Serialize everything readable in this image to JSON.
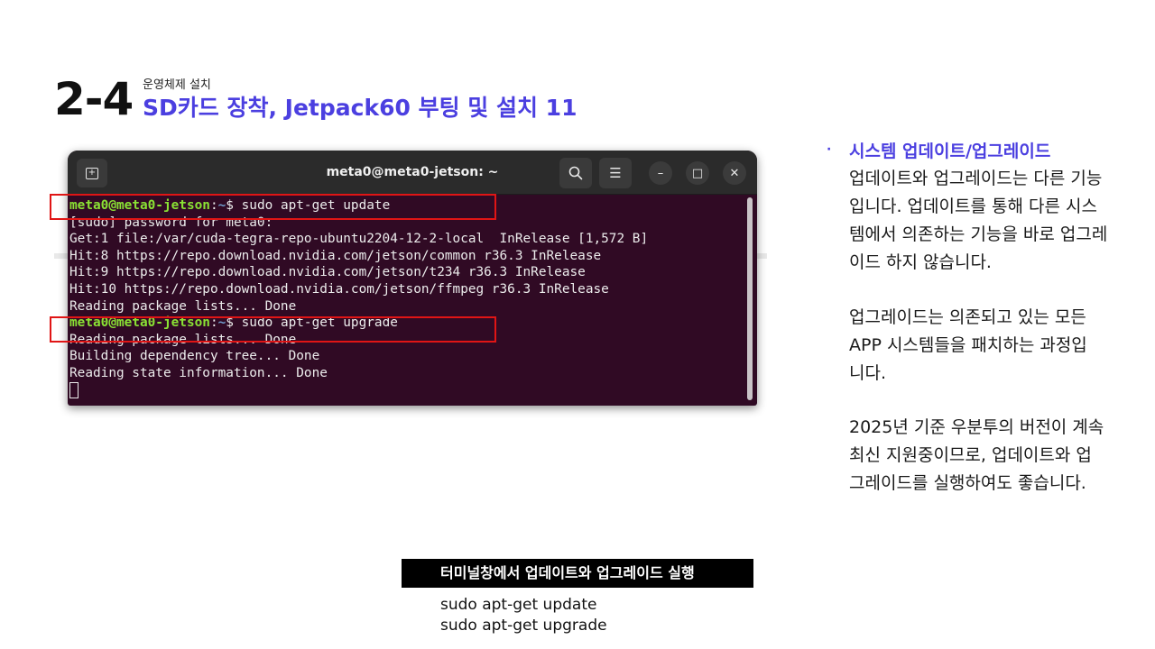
{
  "header": {
    "section_number": "2-4",
    "subtitle": "운영체제 설치",
    "title": "SD카드 장착, Jetpack60 부팅 및 설치 11"
  },
  "terminal": {
    "window_title": "meta0@meta0-jetson: ~",
    "buttons": {
      "new_tab": "⊞",
      "search": "search-icon",
      "menu": "☰",
      "minimize": "–",
      "maximize": "□",
      "close": "✕"
    },
    "prompt_user": "meta0@meta0-jetson",
    "prompt_colon": ":",
    "prompt_path": "~",
    "prompt_sign": "$ ",
    "lines": [
      {
        "kind": "prompt",
        "cmd": "sudo apt-get update"
      },
      {
        "kind": "text",
        "text": "[sudo] password for meta0:"
      },
      {
        "kind": "text",
        "text": "Get:1 file:/var/cuda-tegra-repo-ubuntu2204-12-2-local  InRelease [1,572 B]"
      },
      {
        "kind": "text",
        "text": "Hit:8 https://repo.download.nvidia.com/jetson/common r36.3 InRelease"
      },
      {
        "kind": "text",
        "text": "Hit:9 https://repo.download.nvidia.com/jetson/t234 r36.3 InRelease"
      },
      {
        "kind": "text",
        "text": "Hit:10 https://repo.download.nvidia.com/jetson/ffmpeg r36.3 InRelease"
      },
      {
        "kind": "text",
        "text": "Reading package lists... Done"
      },
      {
        "kind": "prompt",
        "cmd": "sudo apt-get upgrade"
      },
      {
        "kind": "text",
        "text": "Reading package lists... Done"
      },
      {
        "kind": "text",
        "text": "Building dependency tree... Done"
      },
      {
        "kind": "text",
        "text": "Reading state information... Done"
      }
    ]
  },
  "bullets": {
    "title": "시스템 업데이트/업그레이드",
    "paragraphs": [
      [
        "업데이트와 업그레이드는 다른 기능",
        "입니다. 업데이트를 통해 다른 시스",
        "템에서 의존하는 기능을 바로 업그레",
        "이드 하지 않습니다."
      ],
      [
        "업그레이드는 의존되고 있는 모든",
        "APP 시스템들을 패치하는 과정입",
        "니다."
      ],
      [
        "2025년 기준 우분투의 버전이 계속",
        "최신 지원중이므로, 업데이트와 업",
        "그레이드를 실행하여도 좋습니다."
      ]
    ]
  },
  "caption": {
    "title": "터미널창에서 업데이트와 업그레이드 실행",
    "commands": [
      "sudo apt-get update",
      "sudo apt-get upgrade"
    ]
  },
  "colors": {
    "accent": "#4b3fe0",
    "terminal_bg": "#300a24",
    "highlight": "#e01515",
    "prompt_user": "#8ae234",
    "prompt_path": "#729fcf"
  }
}
